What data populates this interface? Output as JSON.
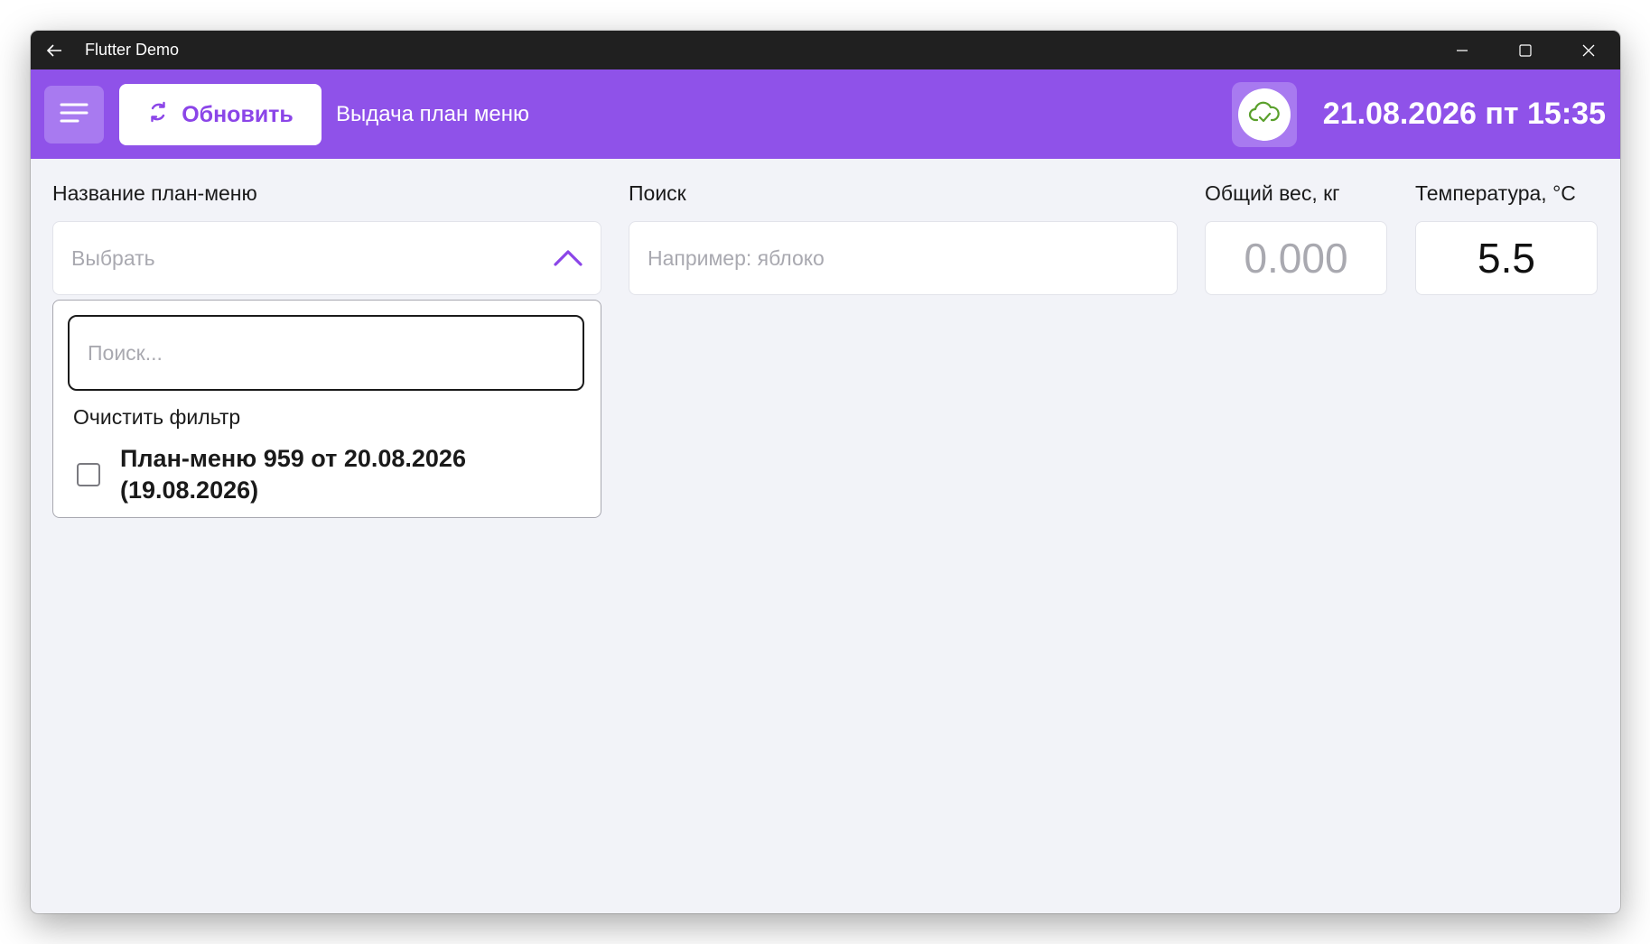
{
  "window": {
    "title": "Flutter Demo"
  },
  "appbar": {
    "refresh_label": "Обновить",
    "page_title": "Выдача план меню",
    "datetime": "21.08.2026 пт 15:35"
  },
  "form": {
    "plan_menu": {
      "label": "Название план-меню",
      "placeholder": "Выбрать"
    },
    "search": {
      "label": "Поиск",
      "placeholder": "Например: яблоко"
    },
    "total_weight": {
      "label": "Общий вес, кг",
      "value": "0.000"
    },
    "temperature": {
      "label": "Температура, °C",
      "value": "5.5"
    }
  },
  "dropdown": {
    "search_placeholder": "Поиск...",
    "clear_filter": "Очистить фильтр",
    "options": [
      {
        "label": "План-меню 959 от 20.08.2026 (19.08.2026)",
        "checked": false
      }
    ]
  },
  "colors": {
    "accent": "#8f52e9",
    "accent_light": "#a87af0",
    "background": "#f2f3f8",
    "cloud_status": "#5aa02c"
  },
  "icons": {
    "back": "arrow-left-icon",
    "menu": "hamburger-menu-icon",
    "refresh": "refresh-icon",
    "cloud": "cloud-check-icon",
    "chevron": "chevron-up-icon"
  }
}
